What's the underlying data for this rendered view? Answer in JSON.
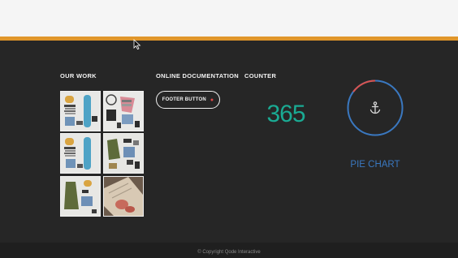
{
  "headings": {
    "our_work": "OUR WORK",
    "online_documentation": "ONLINE DOCUMENTATION",
    "counter": "COUNTER"
  },
  "our_work": {
    "thumbnails": [
      {
        "name": "outfit-flatlay-skateboard"
      },
      {
        "name": "outfit-flatlay-pink-scarf"
      },
      {
        "name": "outfit-flatlay-striped-top"
      },
      {
        "name": "outfit-flatlay-olive-jacket"
      },
      {
        "name": "outfit-flatlay-olive-parka"
      },
      {
        "name": "notebook-closeup"
      }
    ]
  },
  "footer_button": {
    "label": "FOOTER BUTTON",
    "icon": "red-dot-icon"
  },
  "counter": {
    "value": "365"
  },
  "pie_chart": {
    "label": "PIE CHART",
    "icon": "anchor-icon",
    "ring_color": "#3a78c0",
    "segment_color": "#d9534f"
  },
  "colors": {
    "accent": "#e0962a",
    "counter_teal": "#1aaa93",
    "pie_blue": "#3a78c0"
  },
  "copyright": "© Copyright Qode Interactive"
}
